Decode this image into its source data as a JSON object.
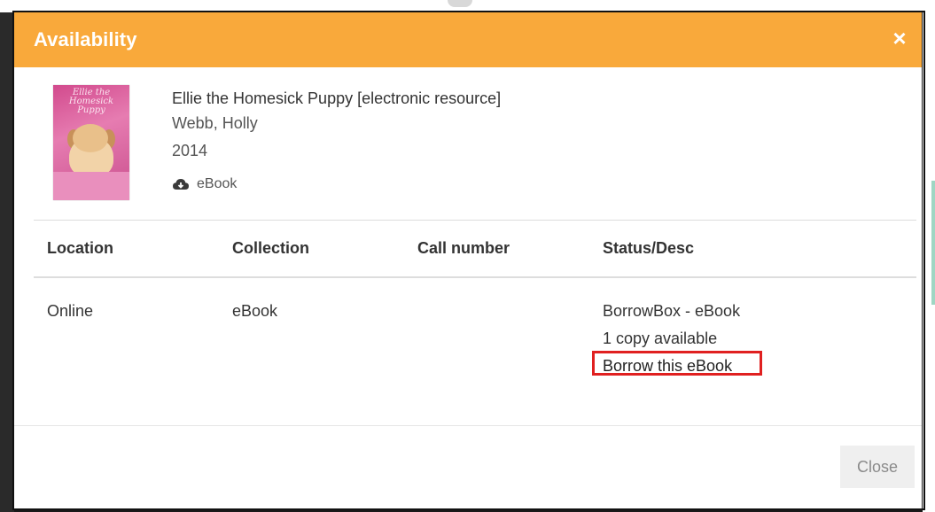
{
  "modal": {
    "title": "Availability",
    "close_icon": "×"
  },
  "record": {
    "title": "Ellie the Homesick Puppy [electronic resource]",
    "author": "Webb, Holly",
    "year": "2014",
    "format_icon": "cloud-download-icon",
    "format": "eBook",
    "cover_text": "Ellie the Homesick Puppy"
  },
  "holdings": {
    "headers": [
      "Location",
      "Collection",
      "Call number",
      "Status/Desc"
    ],
    "rows": [
      {
        "location": "Online",
        "collection": "eBook",
        "call_number": "",
        "status_lines": [
          "BorrowBox - eBook",
          "1 copy available"
        ],
        "borrow_link": "Borrow this eBook"
      }
    ]
  },
  "footer": {
    "close_label": "Close"
  },
  "colors": {
    "header": "#f9a93b",
    "highlight": "#e02020"
  }
}
